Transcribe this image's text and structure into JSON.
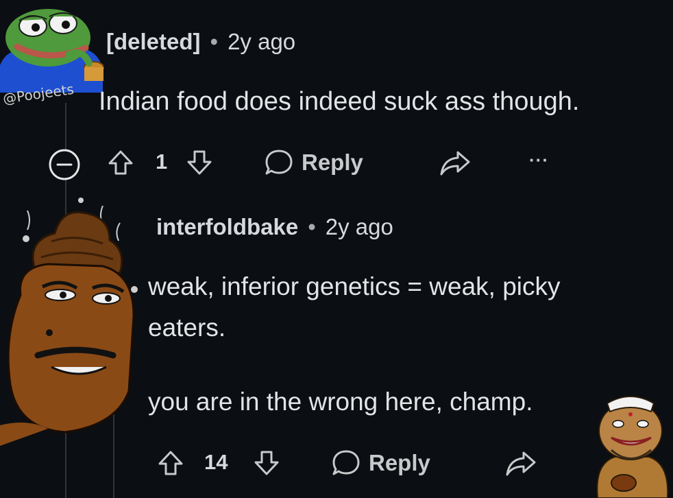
{
  "comment_1": {
    "author": "[deleted]",
    "separator": "•",
    "time": "2y ago",
    "body": "Indian food does indeed suck ass though.",
    "vote_count": "1",
    "reply_label": "Reply",
    "more_label": "···",
    "watermark": "@Poojeets"
  },
  "comment_2": {
    "author": "interfoldbake",
    "separator": "•",
    "time": "2y ago",
    "body_line_1": "weak, inferior genetics = weak, picky",
    "body_line_2": "eaters.",
    "body_line_3": "you are in the wrong here, champ.",
    "vote_count": "14",
    "reply_label": "Reply"
  },
  "icons": {
    "collapse": "minus-circle-icon",
    "upvote": "arrow-up-icon",
    "downvote": "arrow-down-icon",
    "reply": "speech-bubble-icon",
    "share": "share-arrow-icon",
    "more": "ellipsis-icon"
  },
  "colors": {
    "background": "#0b0e12",
    "text": "#d7dadc",
    "thread_line": "#343536"
  }
}
